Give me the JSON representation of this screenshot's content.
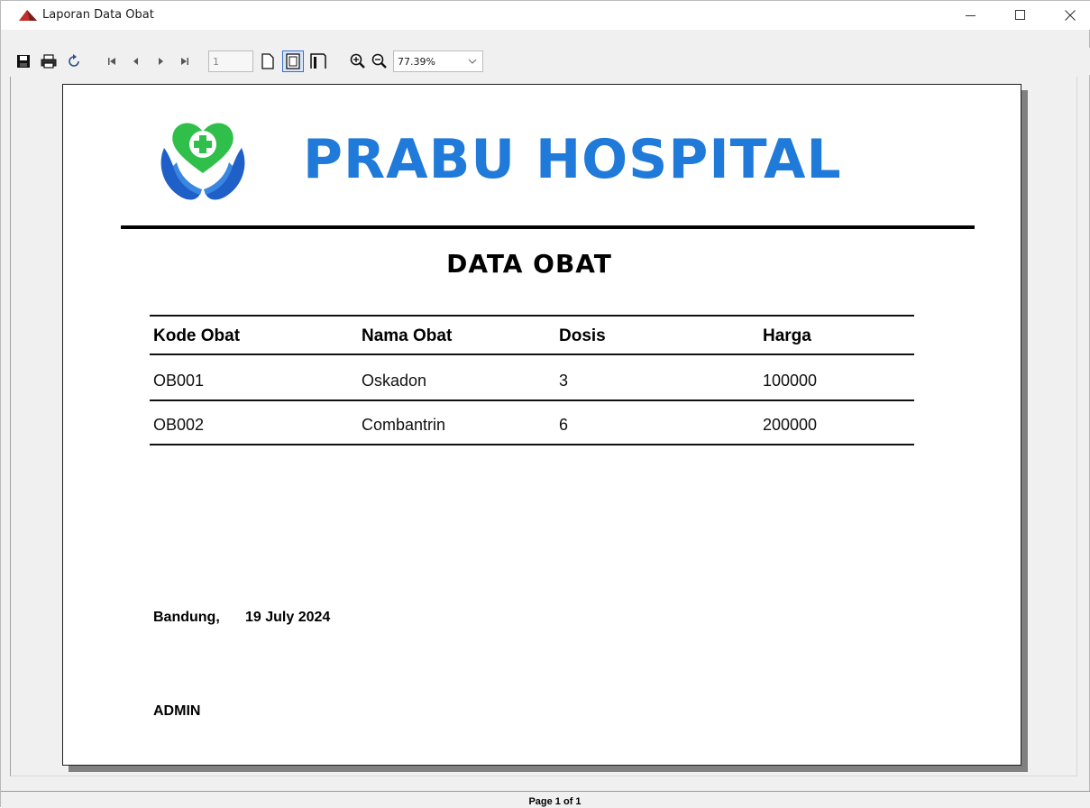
{
  "window": {
    "title": "Laporan Data Obat"
  },
  "toolbar": {
    "page_number": "1",
    "zoom": "77.39%",
    "icons": [
      "save-icon",
      "print-icon",
      "refresh-icon",
      "first-page-icon",
      "previous-page-icon",
      "next-page-icon",
      "last-page-icon",
      "single-page-icon",
      "whole-page-icon",
      "page-width-icon",
      "zoom-in-icon",
      "zoom-out-icon"
    ]
  },
  "report": {
    "hospital_name": "PRABU HOSPITAL",
    "title": "DATA OBAT",
    "columns": [
      "Kode Obat",
      "Nama Obat",
      "Dosis",
      "Harga"
    ],
    "rows": [
      [
        "OB001",
        "Oskadon",
        "3",
        "100000"
      ],
      [
        "OB002",
        "Combantrin",
        "6",
        "200000"
      ]
    ],
    "footer": {
      "place": "Bandung,",
      "date": "19 July 2024",
      "signatory": "ADMIN"
    }
  },
  "status": {
    "page_count": "Page 1 of 1"
  },
  "colors": {
    "brand_blue": "#1f7ad9",
    "logo_green": "#2fbf4a",
    "logo_blue": "#1e5fc8"
  }
}
